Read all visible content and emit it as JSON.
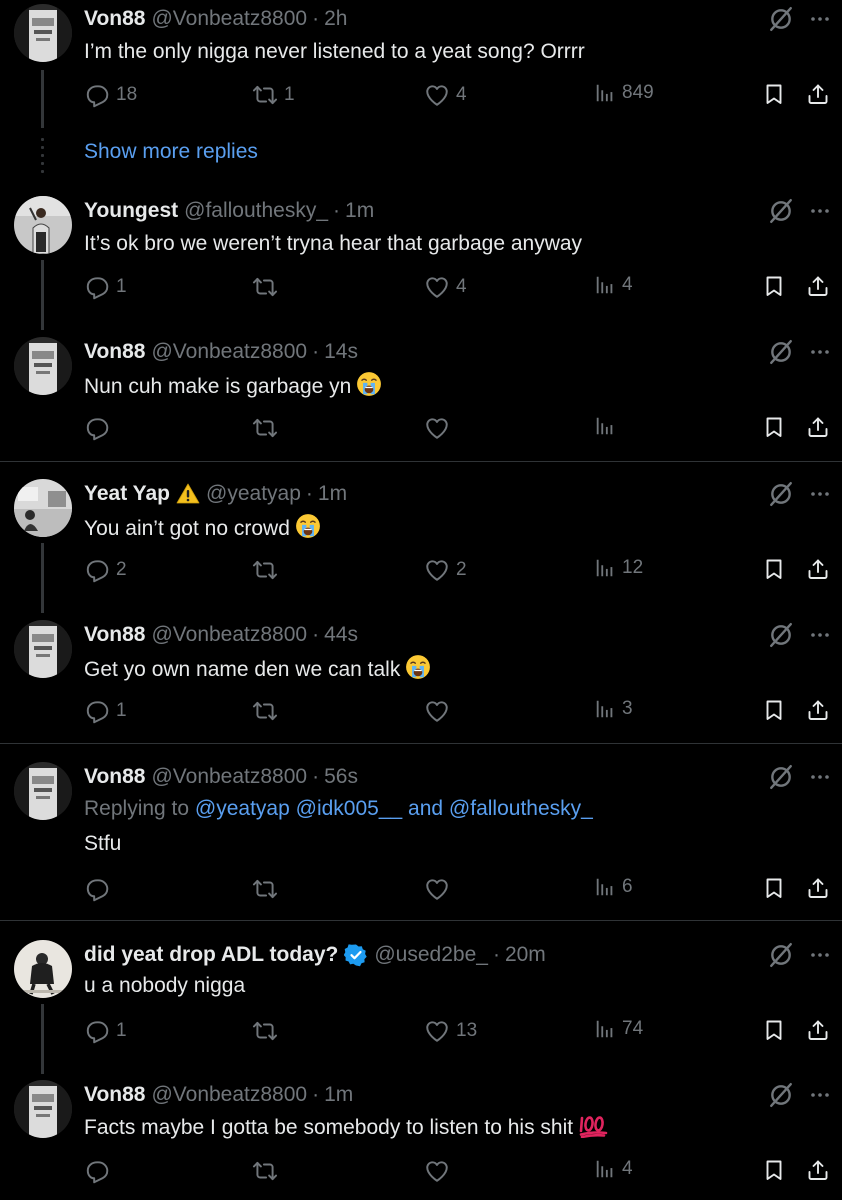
{
  "show_more": "Show more replies",
  "posts": [
    {
      "name": "Von88",
      "handle": "@Vonbeatz8800",
      "time": "2h",
      "text": "I’m the only nigga never listened to a  yeat song? Orrrr",
      "stats": {
        "replies": "18",
        "reposts": "1",
        "likes": "4",
        "views": "849"
      }
    },
    {
      "name": "Youngest",
      "handle": "@fallouthesky_",
      "time": "1m",
      "text": "It’s ok bro we weren’t tryna hear that garbage anyway",
      "stats": {
        "replies": "1",
        "reposts": "",
        "likes": "4",
        "views": "4"
      }
    },
    {
      "name": "Von88",
      "handle": "@Vonbeatz8800",
      "time": "14s",
      "text": "Nun cuh make is garbage yn",
      "stats": {
        "replies": "",
        "reposts": "",
        "likes": "",
        "views": ""
      }
    },
    {
      "name": "Yeat Yap",
      "handle": "@yeatyap",
      "time": "1m",
      "text": "You ain’t got no crowd",
      "stats": {
        "replies": "2",
        "reposts": "",
        "likes": "2",
        "views": "12"
      }
    },
    {
      "name": "Von88",
      "handle": "@Vonbeatz8800",
      "time": "44s",
      "text": "Get yo own name den we can talk",
      "stats": {
        "replies": "1",
        "reposts": "",
        "likes": "",
        "views": "3"
      }
    },
    {
      "name": "Von88",
      "handle": "@Vonbeatz8800",
      "time": "56s",
      "replying_label": "Replying to",
      "replying_m1": "@yeatyap",
      "replying_m2": "@idk005__",
      "replying_and": "and",
      "replying_m3": "@fallouthesky_",
      "text": "Stfu",
      "stats": {
        "replies": "",
        "reposts": "",
        "likes": "",
        "views": "6"
      }
    },
    {
      "name": "did yeat drop ADL today?",
      "handle": "@used2be_",
      "time": "20m",
      "text": "u a nobody nigga",
      "stats": {
        "replies": "1",
        "reposts": "",
        "likes": "13",
        "views": "74"
      }
    },
    {
      "name": "Von88",
      "handle": "@Vonbeatz8800",
      "time": "1m",
      "text": "Facts maybe I gotta be somebody to listen to his shit",
      "stats": {
        "replies": "",
        "reposts": "",
        "likes": "",
        "views": "4"
      }
    }
  ],
  "icons": {
    "reply": "reply-icon",
    "repost": "repost-icon",
    "like": "heart-icon",
    "views": "views-icon",
    "bookmark": "bookmark-icon",
    "share": "share-icon",
    "grok": "grok-icon",
    "more": "more-icon",
    "verified": "verified-icon",
    "warning": "warning-icon",
    "crying": "crying-emoji-icon",
    "hundred": "hundred-emoji-icon"
  },
  "colors": {
    "background": "#000000",
    "text": "#e7e9ea",
    "muted": "#71767b",
    "link": "#5a9ff0",
    "verified": "#1d9bf0",
    "divider": "#2f3336"
  }
}
